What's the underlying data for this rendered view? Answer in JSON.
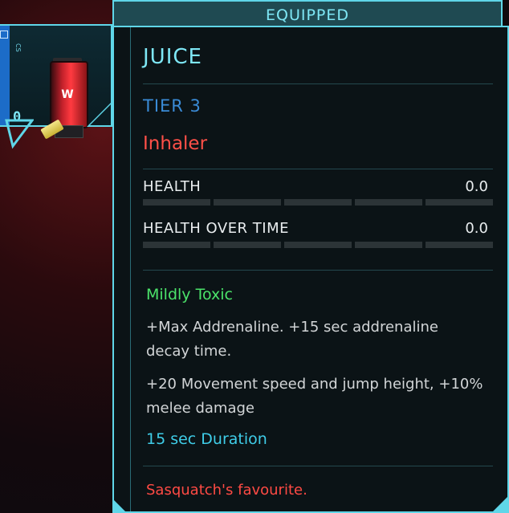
{
  "slot": {
    "count": "0",
    "item_icon": "inhaler-icon",
    "side_text": "CS"
  },
  "tooltip": {
    "header": "EQUIPPED",
    "title": "JUICE",
    "tier": "TIER 3",
    "type": "Inhaler",
    "stats": [
      {
        "label": "HEALTH",
        "value": "0.0",
        "fill": 0
      },
      {
        "label": "HEALTH OVER TIME",
        "value": "0.0",
        "fill": 0
      }
    ],
    "modifier": "Mildly Toxic",
    "effects": [
      "+Max Addrenaline. +15 sec addrenaline decay time.",
      "+20 Movement speed and jump height, +10% melee damage"
    ],
    "duration": "15 sec Duration",
    "flavor": "Sasquatch's favourite."
  },
  "colors": {
    "accent": "#5fd6e8",
    "title": "#7ee7f5",
    "tier": "#3a8bd6",
    "type": "#ff5048",
    "modifier": "#4be36a",
    "duration": "#3fcde8",
    "flavor": "#ff4a44"
  }
}
